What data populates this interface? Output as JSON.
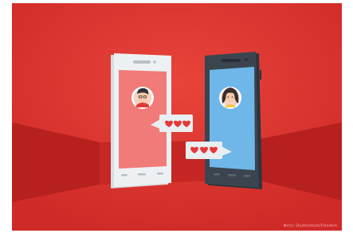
{
  "illustration": {
    "subject": "two smartphones exchanging heart messages",
    "colors": {
      "background": "#d9302c",
      "background_light": "#e8443b",
      "floor_band": "#b6211f",
      "phone_left_body": "#eef1f3",
      "phone_left_screen": "#f07b78",
      "phone_right_body": "#3a4550",
      "phone_right_screen": "#6fb7e9",
      "bubble": "#e9eef1",
      "heart": "#e53939",
      "avatar_ring": "#ffffff"
    },
    "avatars": [
      "boy-avatar",
      "girl-avatar"
    ],
    "bubbles": [
      {
        "hearts": 3
      },
      {
        "hearts": 3
      }
    ]
  },
  "credit": "Фото: Shutterstock/Fotodom"
}
